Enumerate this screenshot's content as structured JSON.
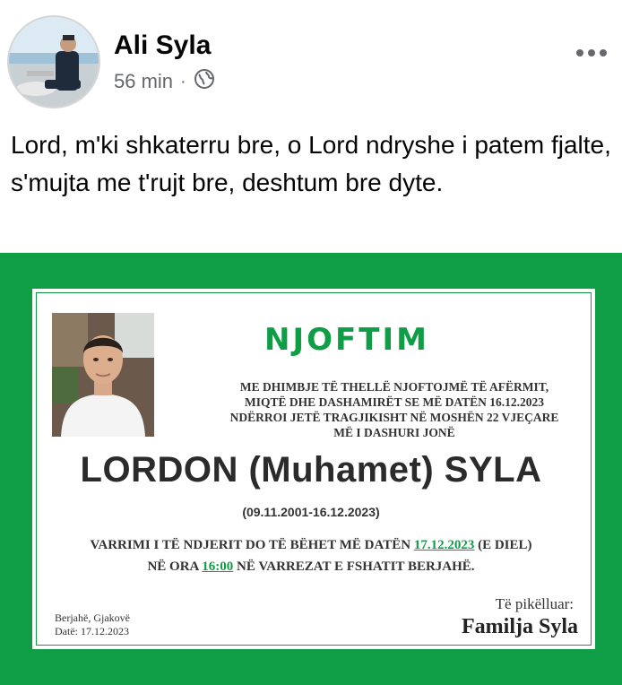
{
  "post": {
    "author": "Ali Syla",
    "time": "56 min",
    "separator": "·",
    "privacy_icon": "globe-icon",
    "more_icon": "more-options-icon",
    "text": "Lord, m'ki shkaterru bre, o Lord ndryshe i patem fjalte, s'mujta me t'rujt bre, deshtum bre dyte."
  },
  "notice": {
    "title": "NJOFTIM",
    "intro_lines": [
      "ME DHIMBJE TË THELLË NJOFTOJMË TË AFËRMIT,",
      "MIQTË DHE DASHAMIRËT SE MË DATËN 16.12.2023",
      "NDËRROI JETË TRAGJIKISHT NË MOSHËN 22 VJEÇARE",
      "MË I DASHURI JONË"
    ],
    "name": "LORDON (Muhamet) SYLA",
    "dates": "(09.11.2001-16.12.2023)",
    "funeral": {
      "line1_pre": "VARRIMI I TË NDJERIT DO TË BËHET MË DATËN ",
      "date": "17.12.2023",
      "line1_post": " (E DIEL)",
      "line2_pre": "NË ORA ",
      "time": "16:00",
      "line2_post": " NË VARREZAT E FSHATIT BERJAHË."
    },
    "place": "Berjahë, Gjakovë",
    "issued": "Datë: 17.12.2023",
    "mourners_label": "Të pikëlluar:",
    "family": "Familja Syla"
  },
  "colors": {
    "accent_green": "#0f9d46",
    "text_dark": "#050505",
    "meta_gray": "#65676b"
  }
}
